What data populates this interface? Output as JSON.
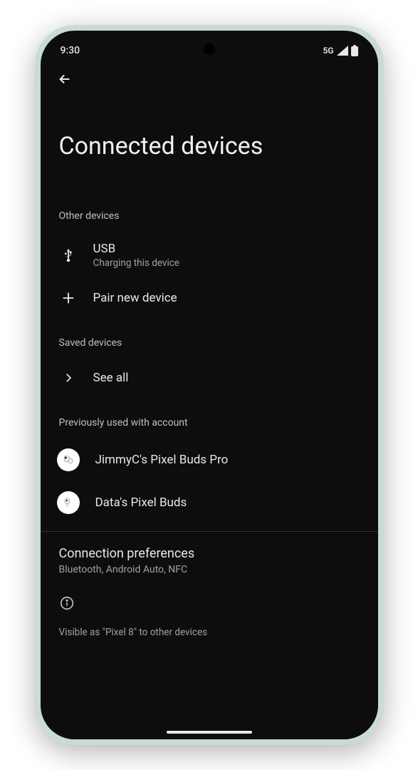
{
  "status": {
    "time": "9:30",
    "network": "5G"
  },
  "page": {
    "title": "Connected devices"
  },
  "sections": {
    "other": {
      "header": "Other devices",
      "usb": {
        "title": "USB",
        "sub": "Charging this device"
      },
      "pair": {
        "title": "Pair new device"
      }
    },
    "saved": {
      "header": "Saved devices",
      "seeAll": {
        "title": "See all"
      }
    },
    "previous": {
      "header": "Previously used with account",
      "items": [
        {
          "title": "JimmyC's Pixel Buds Pro"
        },
        {
          "title": "Data's Pixel Buds"
        }
      ]
    }
  },
  "preferences": {
    "title": "Connection preferences",
    "sub": "Bluetooth, Android Auto, NFC"
  },
  "visibility": {
    "text": "Visible as \"Pixel 8\" to other devices"
  }
}
